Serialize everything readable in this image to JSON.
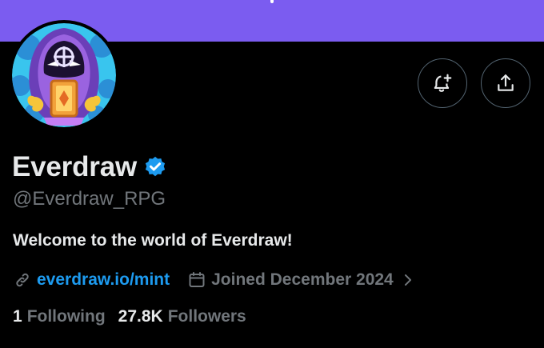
{
  "colors": {
    "banner": "#7b5cf0",
    "background": "#000000",
    "text_primary": "#e7e9ea",
    "text_secondary": "#71767b",
    "link": "#1d9bf0",
    "verified": "#1d9bf0",
    "button_border": "#536471"
  },
  "header": {
    "avatar_icon": "hooded-wizard-avatar",
    "notify_icon": "bell-plus-icon",
    "share_icon": "share-upload-icon"
  },
  "profile": {
    "display_name": "Everdraw",
    "verified_icon": "verified-badge-icon",
    "handle": "@Everdraw_RPG",
    "bio": "Welcome to the world of Everdraw!",
    "link_icon": "link-icon",
    "website": "everdraw.io/mint",
    "calendar_icon": "calendar-icon",
    "joined": "Joined December 2024",
    "chevron_icon": "chevron-right-icon"
  },
  "stats": {
    "following_count": "1",
    "following_label": "Following",
    "followers_count": "27.8K",
    "followers_label": "Followers"
  }
}
